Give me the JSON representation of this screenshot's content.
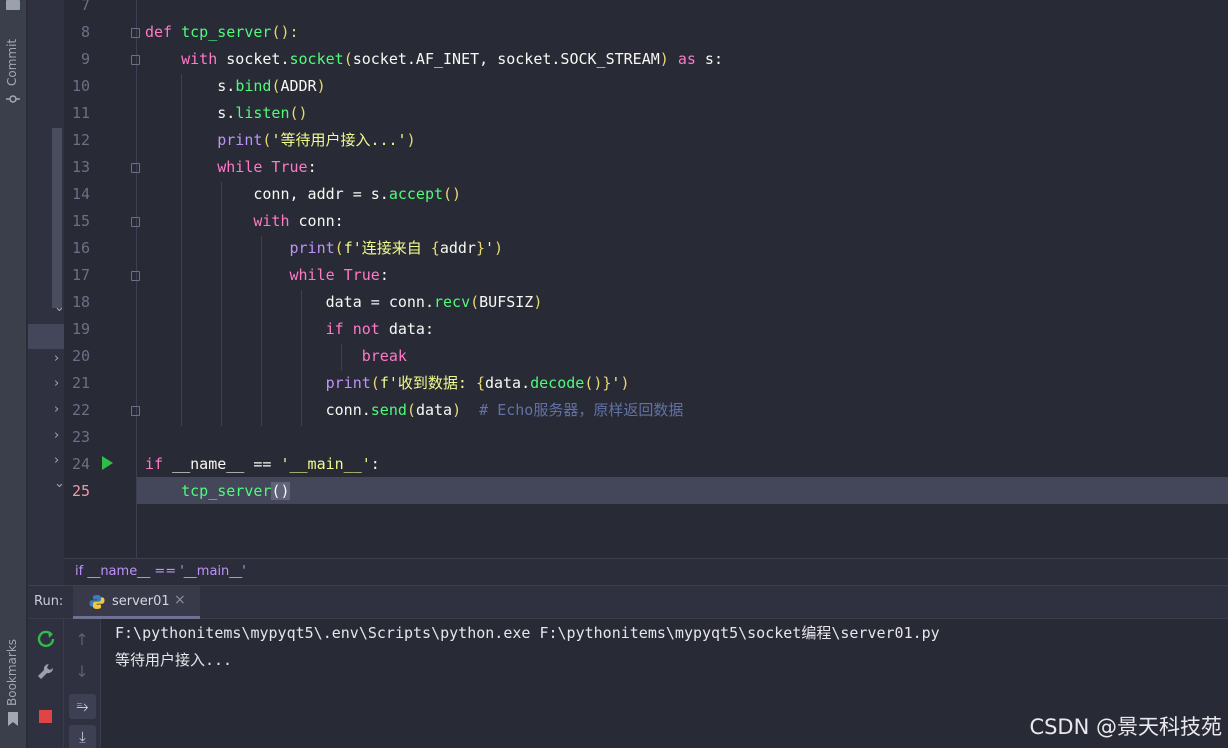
{
  "sidebar": {
    "commit_label": "Commit",
    "bookmarks_label": "Bookmarks"
  },
  "editor": {
    "line_numbers": [
      "7",
      "8",
      "9",
      "10",
      "11",
      "12",
      "13",
      "14",
      "15",
      "16",
      "17",
      "18",
      "19",
      "20",
      "21",
      "22",
      "23",
      "24",
      "25"
    ],
    "current_line": "25",
    "lines": {
      "l8": {
        "kw": "def",
        "fn": "tcp_server",
        "rest": "():"
      },
      "l9": {
        "kw": "with",
        "a": " socket.",
        "fn": "socket",
        "p1": "(",
        "b": "socket.AF_INET, socket.SOCK_STREAM",
        "p2": ")",
        "as": " as",
        "c": " s:"
      },
      "l10": {
        "a": "s.",
        "fn": "bind",
        "p1": "(",
        "b": "ADDR",
        "p2": ")"
      },
      "l11": {
        "a": "s.",
        "fn": "listen",
        "p": "()"
      },
      "l12": {
        "bu": "print",
        "p1": "(",
        "st": "'等待用户接入...'",
        "p2": ")"
      },
      "l13": {
        "kw": "while",
        "kw2": " True",
        "c": ":"
      },
      "l14": {
        "a": "conn, addr = s.",
        "fn": "accept",
        "p": "()"
      },
      "l15": {
        "kw": "with",
        "c": " conn:"
      },
      "l16": {
        "bu": "print",
        "p1": "(",
        "st1": "f'连接来自 ",
        "b1": "{",
        "v": "addr",
        "b2": "}",
        "st2": "'",
        "p2": ")"
      },
      "l17": {
        "kw": "while",
        "kw2": " True",
        "c": ":"
      },
      "l18": {
        "a": "data = conn.",
        "fn": "recv",
        "p1": "(",
        "b": "BUFSIZ",
        "p2": ")"
      },
      "l19": {
        "kw": "if",
        "kw2": " not",
        "c": " data:"
      },
      "l20": {
        "kw": "break"
      },
      "l21": {
        "bu": "print",
        "p1": "(",
        "st1": "f'收到数据: ",
        "b1": "{",
        "v": "data.",
        "fn": "decode",
        "pp": "()",
        "b2": "}",
        "st2": "'",
        "p2": ")"
      },
      "l22": {
        "a": "conn.",
        "fn": "send",
        "p1": "(",
        "b": "data",
        "p2": ")",
        "cm": "  # Echo服务器，原样返回数据"
      },
      "l24": {
        "kw": "if",
        "a": " __name__ == ",
        "st": "'__main__'",
        "c": ":"
      },
      "l25": {
        "fn": "tcp_server",
        "p1": "(",
        "p2": ")"
      }
    }
  },
  "breadcrumb": {
    "text": "if __name__ == '__main__'"
  },
  "run_panel": {
    "label": "Run:",
    "tab_label": "server01",
    "close_glyph": "×",
    "console_lines": [
      "F:\\pythonitems\\mypyqt5\\.env\\Scripts\\python.exe F:\\pythonitems\\mypyqt5\\socket编程\\server01.py",
      "等待用户接入..."
    ],
    "tool_icons": [
      "rerun-icon",
      "wrench-icon",
      "stop-icon",
      "up-arrow-icon",
      "down-arrow-icon",
      "soft-wrap-icon",
      "scroll-to-end-icon"
    ]
  },
  "watermark": "CSDN @景天科技苑",
  "colors": {
    "background": "#282a36",
    "keyword": "#ff79c6",
    "function": "#50fa7b",
    "string": "#f1fa8c",
    "builtin": "#bd93f9",
    "comment": "#6272a4",
    "run_green": "#2fbd48",
    "stop_red": "#e04545"
  }
}
